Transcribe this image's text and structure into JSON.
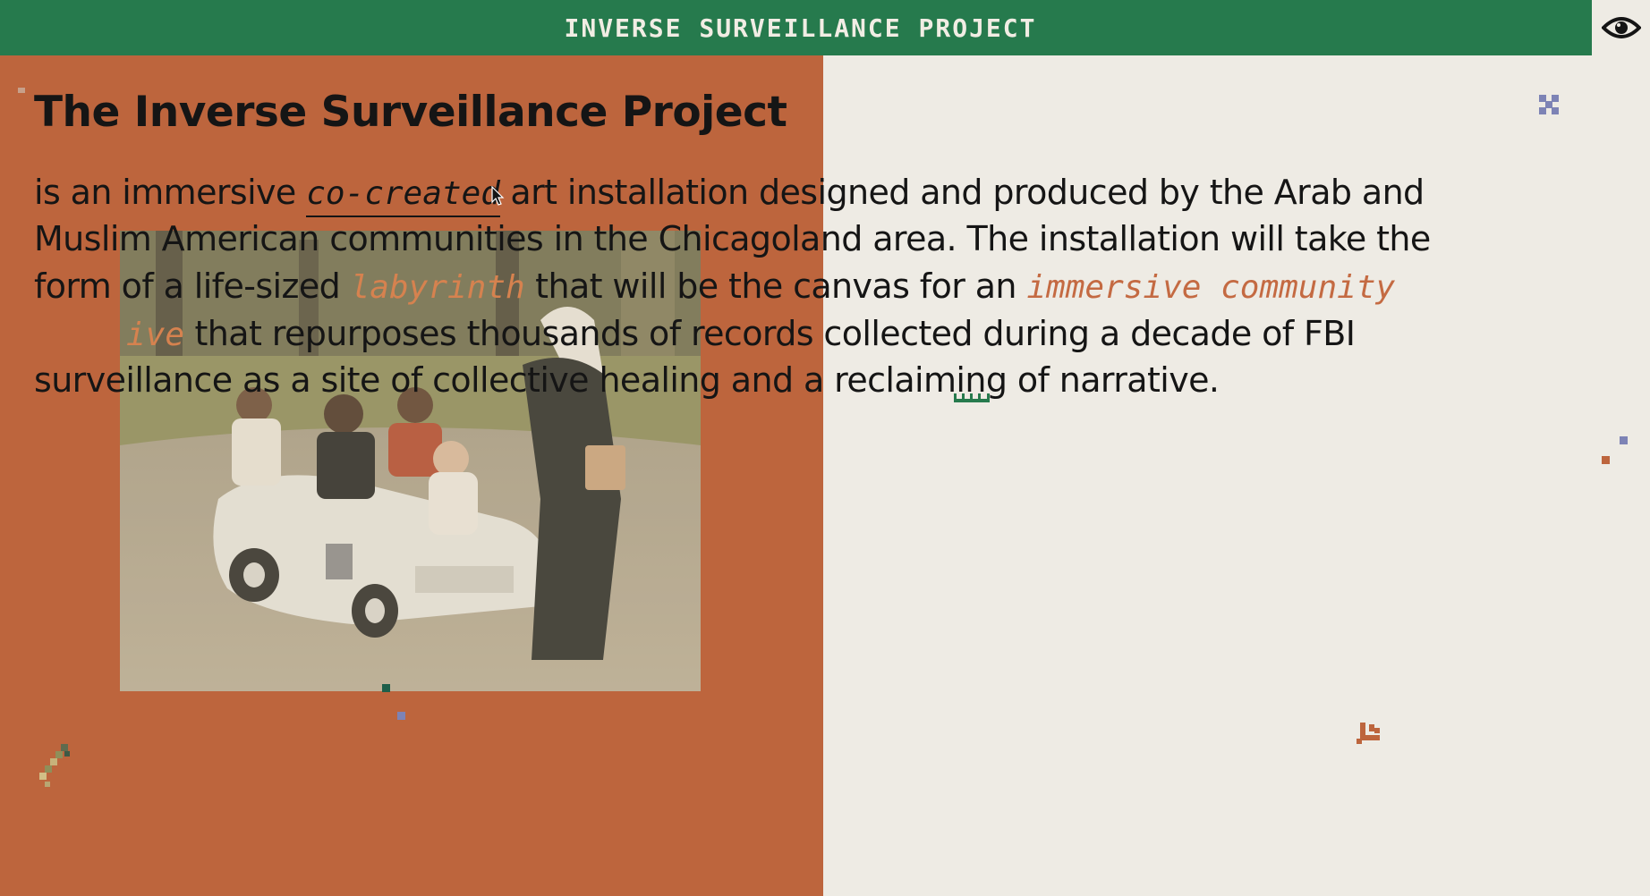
{
  "header": {
    "site_title": "INVERSE SURVEILLANCE PROJECT",
    "eye_icon": "eye-icon"
  },
  "main": {
    "heading": "The Inverse Surveillance Project",
    "paragraph": {
      "line1_a": "is an immersive ",
      "link_co_created": "co-created",
      "line1_b": " art installation designed and produced by the Arab and",
      "line2": "Muslim American communities in the Chicagoland area. The installation will take the",
      "line3_a": "form of a life-sized ",
      "labyrinth": "labyrinth",
      "line3_b": " that will be the canvas for an ",
      "immersive_community": "immersive community",
      "line4_fragment": "ive",
      "line4_b": " that repurposes thousands of records collected during a decade of FBI",
      "line5": "surveillance as a site of collective healing and a reclaiming of narrative."
    }
  },
  "colors": {
    "header_green": "#267a4d",
    "panel_orange": "#bd653d",
    "background_cream": "#eeebe4",
    "accent_orange": "#c46a42"
  },
  "photo": {
    "icon": "family-photo"
  }
}
